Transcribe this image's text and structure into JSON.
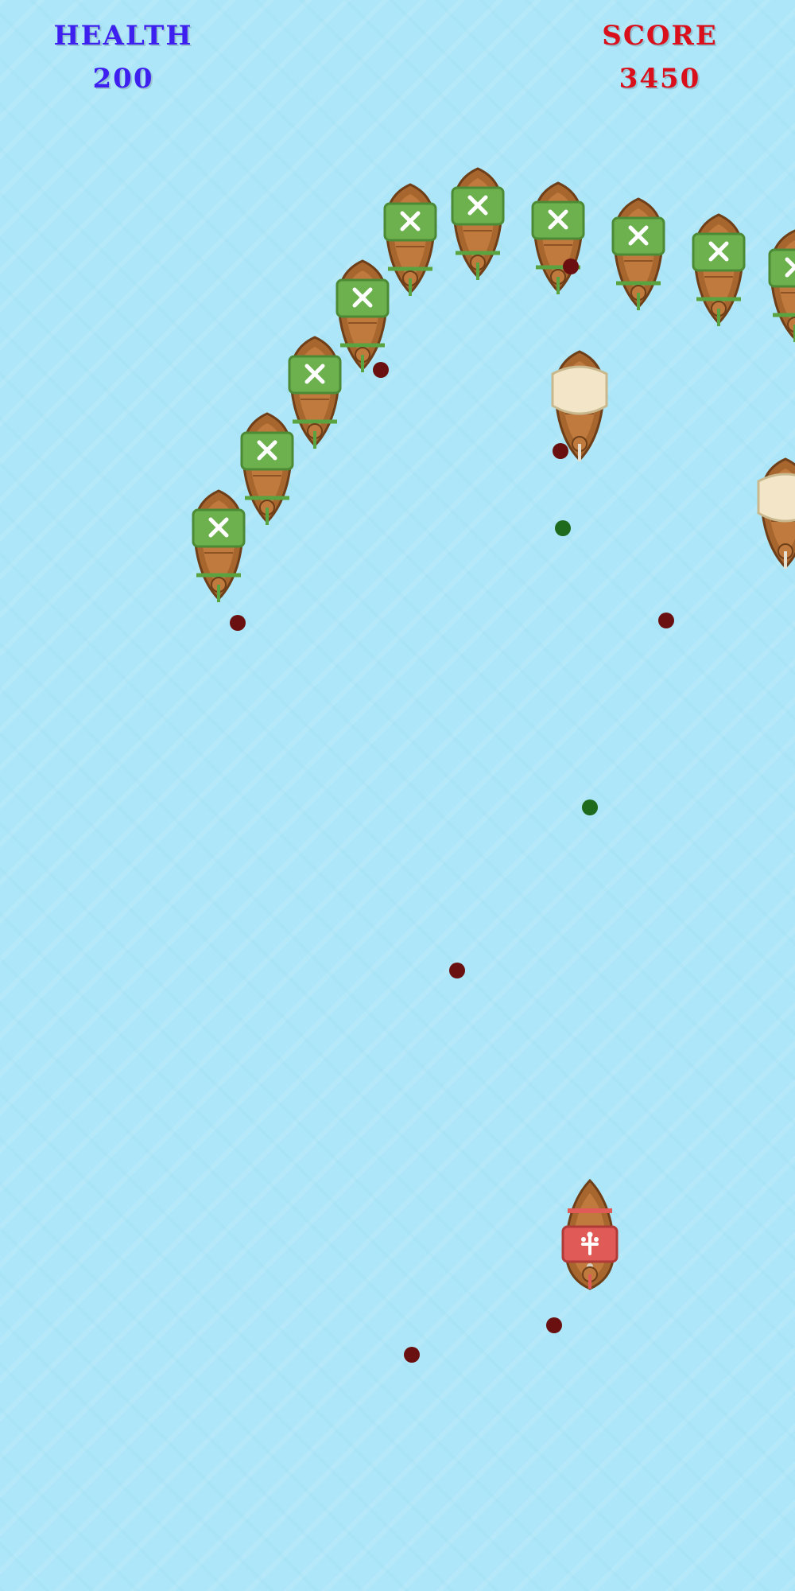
{
  "hud": {
    "health_label": "HEALTH",
    "health_value": "200",
    "score_label": "SCORE",
    "score_value": "3450"
  },
  "colors": {
    "water": "#ade6f8",
    "health_text": "#3d1ff0",
    "score_text": "#d90f1b",
    "pirate_sail": "#6db14f",
    "merchant_sail": "#f3e6c8",
    "player_sail": "#e05a57",
    "hull": "#a8662f",
    "enemy_cannonball": "#6b1010",
    "player_cannonball": "#1e6b1e"
  },
  "icons": {
    "pirate_sail_emblem": "crossed-swords-icon",
    "player_sail_emblem": "fleur-de-lis-icon"
  }
}
